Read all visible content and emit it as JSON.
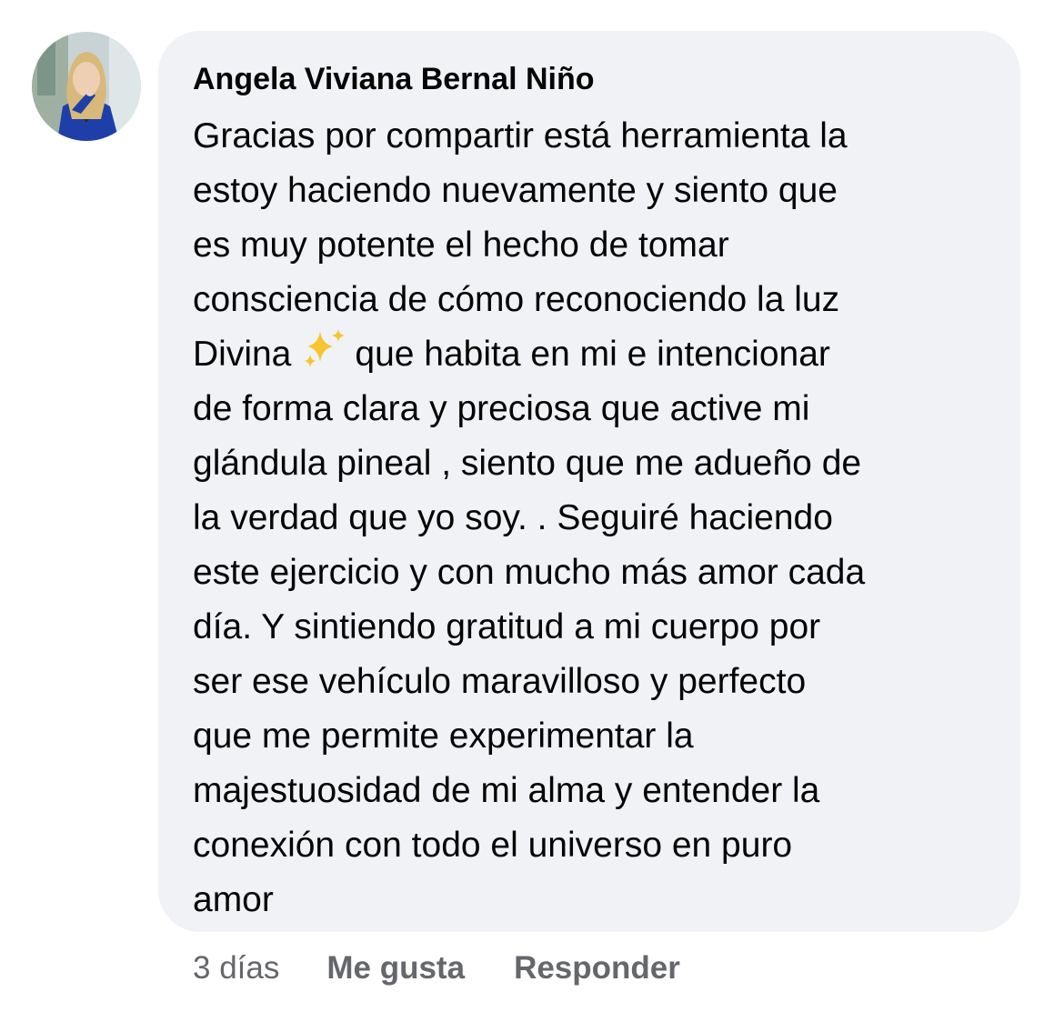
{
  "comment": {
    "author": "Angela Viviana Bernal Niño",
    "lines": [
      "Gracias por compartir está herramienta la",
      "estoy haciendo nuevamente y siento que",
      "es muy potente el hecho de tomar",
      "consciencia de cómo reconociendo la luz",
      "Divina",
      "que habita en mi e intencionar",
      "de forma clara y preciosa que active mi",
      "glándula pineal , siento que me adueño de",
      "la verdad que yo soy. . Seguiré haciendo",
      "este ejercicio y con mucho más amor cada",
      "día. Y sintiendo gratitud a mi cuerpo por",
      "ser ese vehículo maravilloso y perfecto",
      "que me permite experimentar la",
      "majestuosidad de mi alma y entender la",
      "conexión con todo el universo en puro",
      "amor"
    ],
    "emoji": "sparkles-icon",
    "timestamp": "3 días",
    "like_label": "Me gusta",
    "reply_label": "Responder"
  },
  "colors": {
    "bubble_bg": "#f0f2f5",
    "text": "#050505",
    "secondary_text": "#65676b"
  }
}
